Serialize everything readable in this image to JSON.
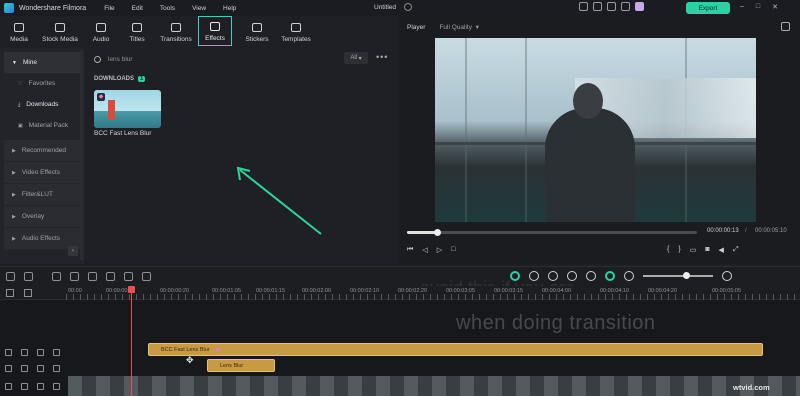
{
  "app": {
    "title": "Wondershare Filmora",
    "document_title": "Untitled",
    "export_label": "Export"
  },
  "menu": [
    "File",
    "Edit",
    "Tools",
    "View",
    "Help"
  ],
  "tools": [
    {
      "label": "Media",
      "icon": "media-icon"
    },
    {
      "label": "Stock Media",
      "icon": "stock-media-icon"
    },
    {
      "label": "Audio",
      "icon": "music-note-icon"
    },
    {
      "label": "Titles",
      "icon": "text-icon"
    },
    {
      "label": "Transitions",
      "icon": "transition-icon"
    },
    {
      "label": "Effects",
      "icon": "effects-star-icon",
      "active": true
    },
    {
      "label": "Stickers",
      "icon": "sticker-icon"
    },
    {
      "label": "Templates",
      "icon": "templates-icon"
    }
  ],
  "sidebar": {
    "mine": "Mine",
    "items": [
      "Favorites",
      "Downloads",
      "Material Pack"
    ],
    "sections": [
      "Recommended",
      "Video Effects",
      "Filter&LUT",
      "Overlay",
      "Audio Effects"
    ]
  },
  "content": {
    "search_value": "lens blur",
    "filter_value": "All",
    "section_label": "DOWNLOADS",
    "section_count": "1",
    "effect_name": "BCC Fast Lens Blur"
  },
  "player": {
    "label": "Player",
    "quality": "Full Quality",
    "current_time": "00:00:00:13",
    "total_time": "00:00:05:10",
    "progress_fraction": 0.1
  },
  "timeline": {
    "ruler_labels": [
      "00:00",
      "00:00:00:10",
      "00:00:00:20",
      "00:00:01:05",
      "00:00:01:15",
      "00:00:02:00",
      "00:00:02:10",
      "00:00:02:20",
      "00:00:03:05",
      "00:00:03:15",
      "00:00:04:00",
      "00:00:04:10",
      "00:00:04:20",
      "00:00:05:05"
    ],
    "clip_fx_label": "BCC Fast Lens Blur",
    "clip_fx2_label": "Lens Blur",
    "overlay_text": "when doing transition",
    "overlay_text_faint": "avoid this if you are"
  },
  "watermark": "wtvid.com",
  "colors": {
    "accent": "#29d1a3",
    "playhead": "#ee4d4d",
    "clip": "#c79a44"
  }
}
